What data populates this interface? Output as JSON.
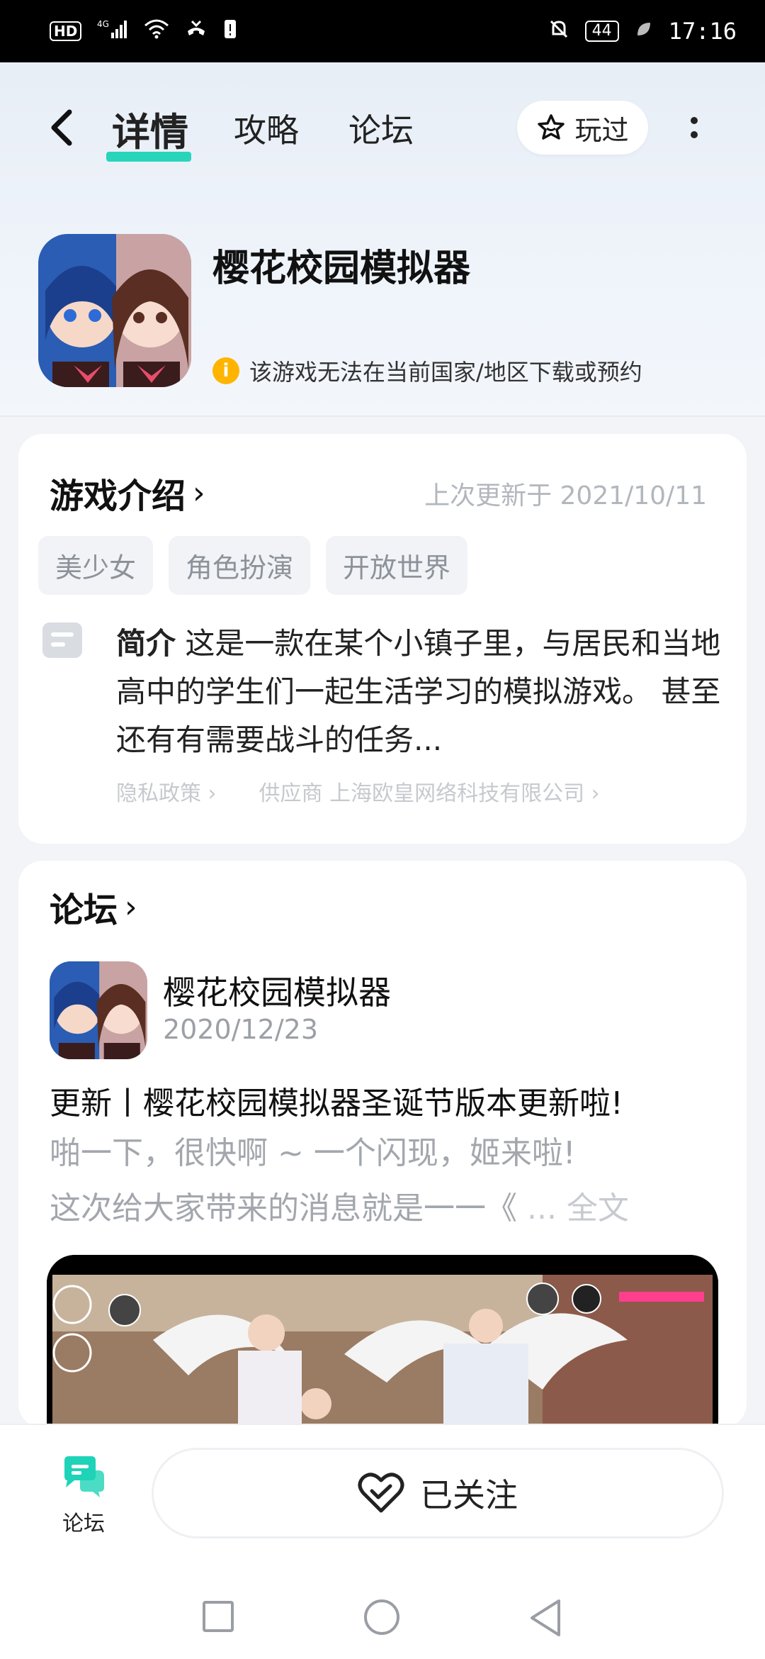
{
  "status_bar": {
    "left_badge": "HD",
    "network": "4G",
    "battery": "44",
    "time": "17:16"
  },
  "nav": {
    "tabs": [
      {
        "label": "详情",
        "active": true
      },
      {
        "label": "攻略",
        "active": false
      },
      {
        "label": "论坛",
        "active": false
      }
    ],
    "played_label": "玩过"
  },
  "app": {
    "title": "樱花校园模拟器",
    "region_note": "该游戏无法在当前国家/地区下载或预约"
  },
  "intro": {
    "title": "游戏介绍",
    "updated": "上次更新于 2021/10/11",
    "tags": [
      "美少女",
      "角色扮演",
      "开放世界"
    ],
    "desc_label": "简介",
    "desc_text": " 这是一款在某个小镇子里，与居民和当地高中的学生们一起生活学习的模拟游戏。 甚至还有有需要战斗的任务...",
    "privacy_label": "隐私政策",
    "supplier_label": "供应商 上海欧皇网络科技有限公司"
  },
  "forum": {
    "title": "论坛",
    "post": {
      "author": "樱花校园模拟器",
      "date": "2020/12/23",
      "title": "更新丨樱花校园模拟器圣诞节版本更新啦!",
      "excerpt_line1": "啪一下，很快啊 ~ 一个闪现，姬来啦!",
      "excerpt_line2": "这次给大家带来的消息就是一一《",
      "more_label": " ... 全文"
    }
  },
  "bottom": {
    "forum_tab_label": "论坛",
    "follow_label": "已关注"
  },
  "colors": {
    "accent": "#1ed3b7",
    "warning": "#ffb400"
  }
}
